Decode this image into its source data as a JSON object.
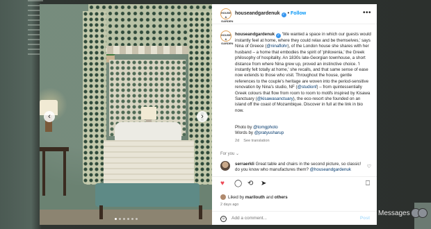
{
  "background": {
    "messages_label": "Messages"
  },
  "post": {
    "username": "houseandgardenuk",
    "follow_label": "Follow",
    "more_label": "•••",
    "avatar_text": "HOUSE & GARDEN",
    "caption": {
      "intro": "'We wanted a space in which our guests would instantly feel at home, where they could relax and be themselves,' says Nina of Greece (",
      "mention1": "@ninaflohr",
      "part2": "), of the London house she shares with her husband – a home that embodies the spirit of 'philoxenia,' the Greek philosophy of hospitality. An 1830s late-Georgian townhouse, a short distance from where Nina grew up, proved an instinctive choice. 'I instantly felt totally at home,' she recalls, and that same sense of ease now extends to those who visit. Throughout the house, gentle references to the couple's heritage are woven into the period-sensitive renovation by Nina's studio, NF (",
      "mention2": "@studionf",
      "part3": ") – from quintessentially Greek colours that flow from room to room to motifs inspired by Kisawa Sanctuary (",
      "mention3": "@kisawasanctuary",
      "part4": "), the eco-resort she founded on an island off the coast of Mozambique. Discover in full at the link in bio now."
    },
    "credits": {
      "photo_prefix": "Photo by ",
      "photo_handle": "@tomgphoto",
      "words_prefix": "Words by ",
      "words_handle": "@pratyusharup"
    },
    "age_short": "2d",
    "see_translation": "See translation",
    "for_you": "For you",
    "comment": {
      "username": "serraerkli",
      "text": "Great table and chairs in the second picture, so classic!",
      "text2": "do you know who manufactures them?",
      "mention": "@houseandgardenuk"
    },
    "likes": {
      "prefix": "Liked by ",
      "user": "marilouth",
      "and": " and ",
      "others": "others"
    },
    "time_ago": "2 days ago",
    "add_comment_placeholder": "Add a comment...",
    "post_label": "Post"
  },
  "icons": {
    "prev": "‹",
    "next": "›",
    "heart": "♥",
    "comment": "◯",
    "repost": "⟲",
    "share": "➤",
    "save": "⎕",
    "emoji": "☺",
    "small_heart": "♡",
    "verified": "✓"
  },
  "colors": {
    "accent": "#0095f6",
    "like": "#ed4956",
    "text": "#262626",
    "muted": "#737373"
  }
}
